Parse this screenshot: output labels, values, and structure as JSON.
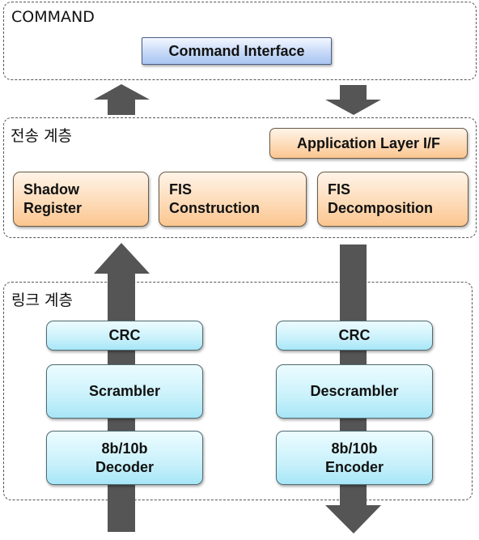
{
  "command_group": {
    "label": "COMMAND",
    "interface_box": "Command Interface"
  },
  "transport_group": {
    "label": "전송 계층",
    "app_layer_box": "Application Layer I/F",
    "blocks": [
      {
        "line1": "Shadow",
        "line2": "Register"
      },
      {
        "line1": "FIS",
        "line2": "Construction"
      },
      {
        "line1": "FIS",
        "line2": "Decomposition"
      }
    ]
  },
  "link_group": {
    "label": "링크 계층",
    "receive_path": {
      "crc": "CRC",
      "scrambler": "Scrambler",
      "codec_line1": "8b/10b",
      "codec_line2": "Decoder"
    },
    "transmit_path": {
      "crc": "CRC",
      "scrambler": "Descrambler",
      "codec_line1": "8b/10b",
      "codec_line2": "Encoder"
    }
  },
  "arrows": {
    "color": "#555555",
    "items": [
      {
        "name": "upward-to-command",
        "direction": "up"
      },
      {
        "name": "downward-from-command",
        "direction": "down"
      },
      {
        "name": "upward-through-link",
        "direction": "up"
      },
      {
        "name": "downward-through-link",
        "direction": "down"
      }
    ]
  },
  "colors": {
    "command_box": "#c6d9f7",
    "transport_boxes": "#fdd9b4",
    "link_boxes": "#c9f1fb"
  }
}
